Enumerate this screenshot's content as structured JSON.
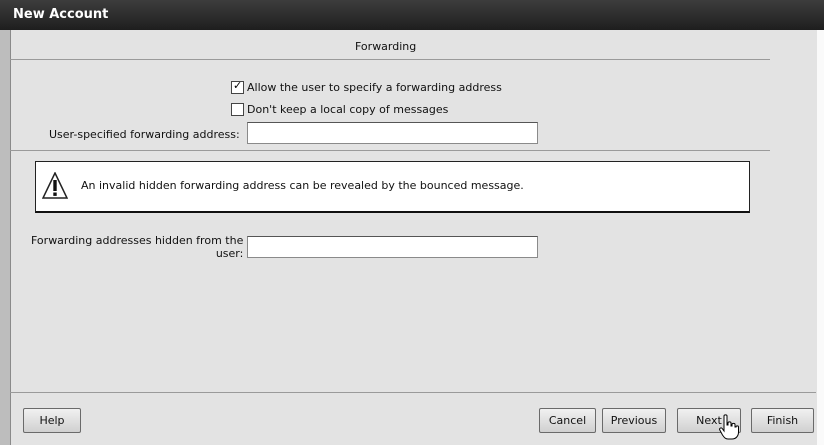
{
  "window": {
    "title": "New Account"
  },
  "section": {
    "title": "Forwarding"
  },
  "options": {
    "allow_forwarding": {
      "label": "Allow the user to specify a forwarding address",
      "checked": true
    },
    "no_local_copy": {
      "label": "Don't keep a local copy of messages",
      "checked": false
    }
  },
  "fields": {
    "user_forwarding": {
      "label": "User-specified forwarding address:",
      "value": ""
    },
    "hidden_forwarding": {
      "label_line1": "Forwarding addresses hidden from the",
      "label_line2": "user:",
      "value": ""
    }
  },
  "warning": {
    "icon": "warning-icon",
    "message": "An invalid hidden forwarding address can be revealed by the bounced message."
  },
  "buttons": {
    "help": "Help",
    "cancel": "Cancel",
    "previous": "Previous",
    "next": "Next",
    "finish": "Finish"
  }
}
